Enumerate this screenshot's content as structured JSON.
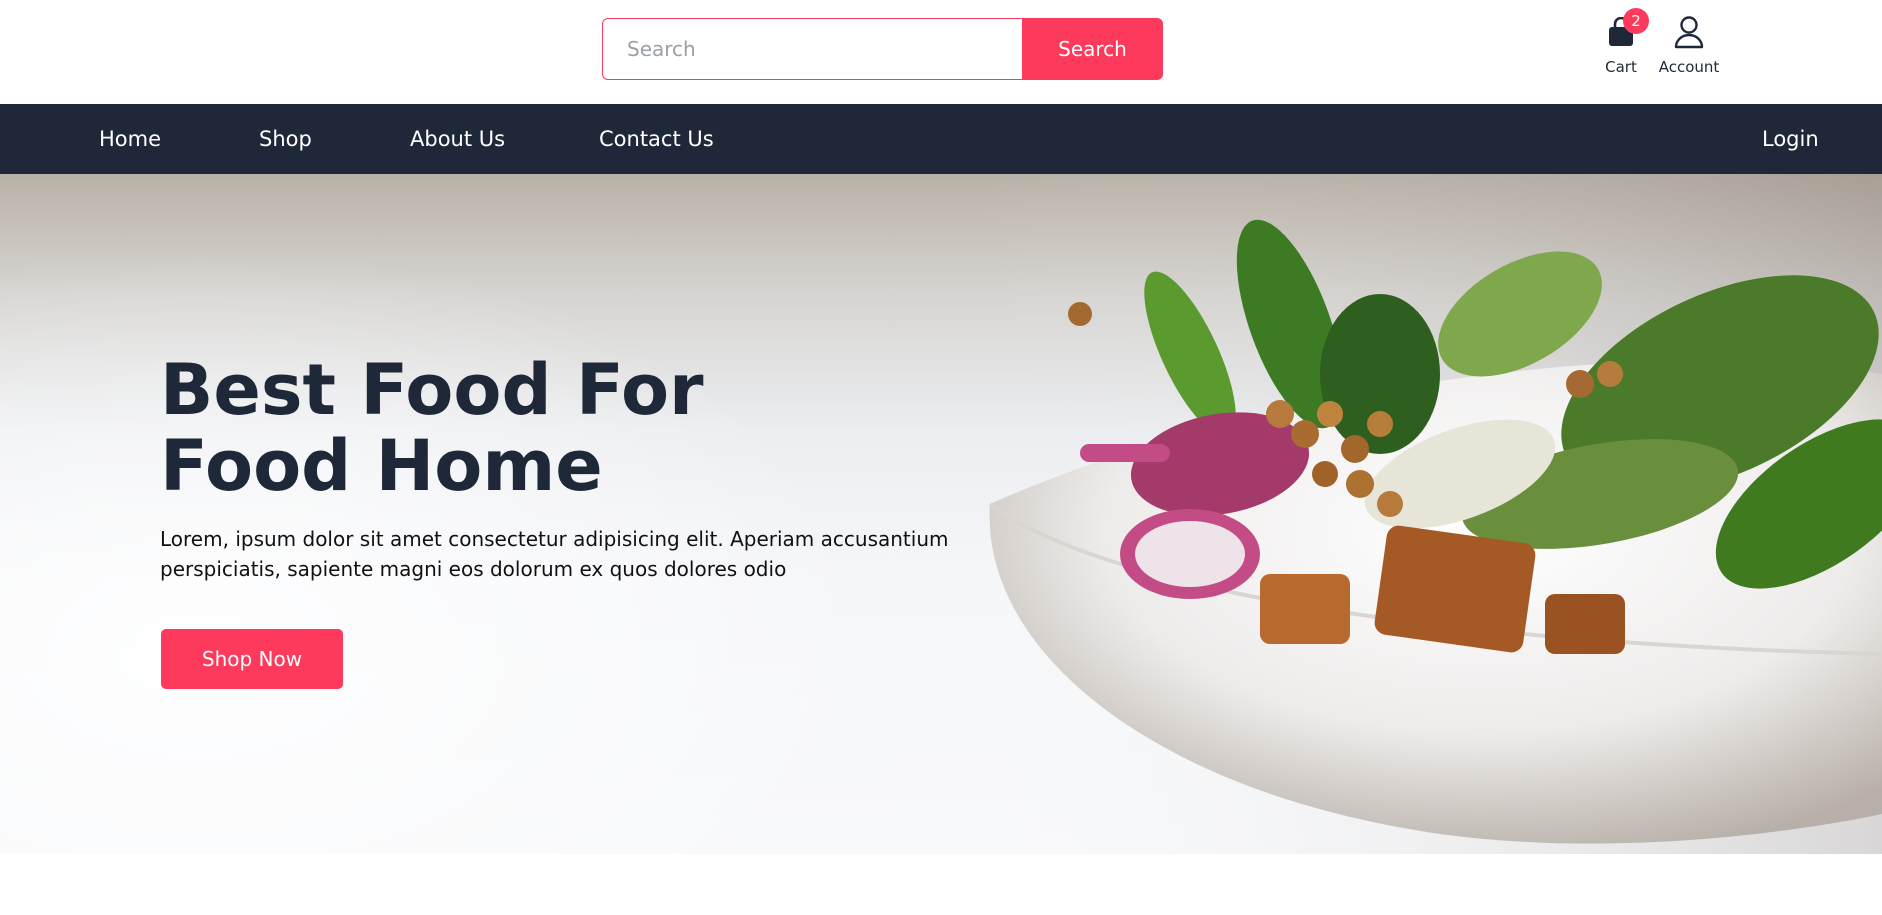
{
  "header": {
    "search": {
      "placeholder": "Search",
      "value": "",
      "button_label": "Search"
    },
    "cart": {
      "label": "Cart",
      "count": "2",
      "icon": "shopping-bag-icon"
    },
    "account": {
      "label": "Account",
      "icon": "user-icon"
    }
  },
  "nav": {
    "items": [
      {
        "label": "Home"
      },
      {
        "label": "Shop"
      },
      {
        "label": "About Us"
      },
      {
        "label": "Contact Us"
      }
    ],
    "login_label": "Login"
  },
  "hero": {
    "title": "Best Food For\nFood Home",
    "text": "Lorem, ipsum dolor sit amet consectetur adipisicing elit. Aperiam accusantium perspiciatis, sapiente magni eos dolorum ex quos dolores odio",
    "button_label": "Shop Now",
    "image": "salad-bowl-image"
  },
  "colors": {
    "accent": "#fe3a5c",
    "nav_bg": "#1f2839",
    "heading": "#1f2839"
  }
}
